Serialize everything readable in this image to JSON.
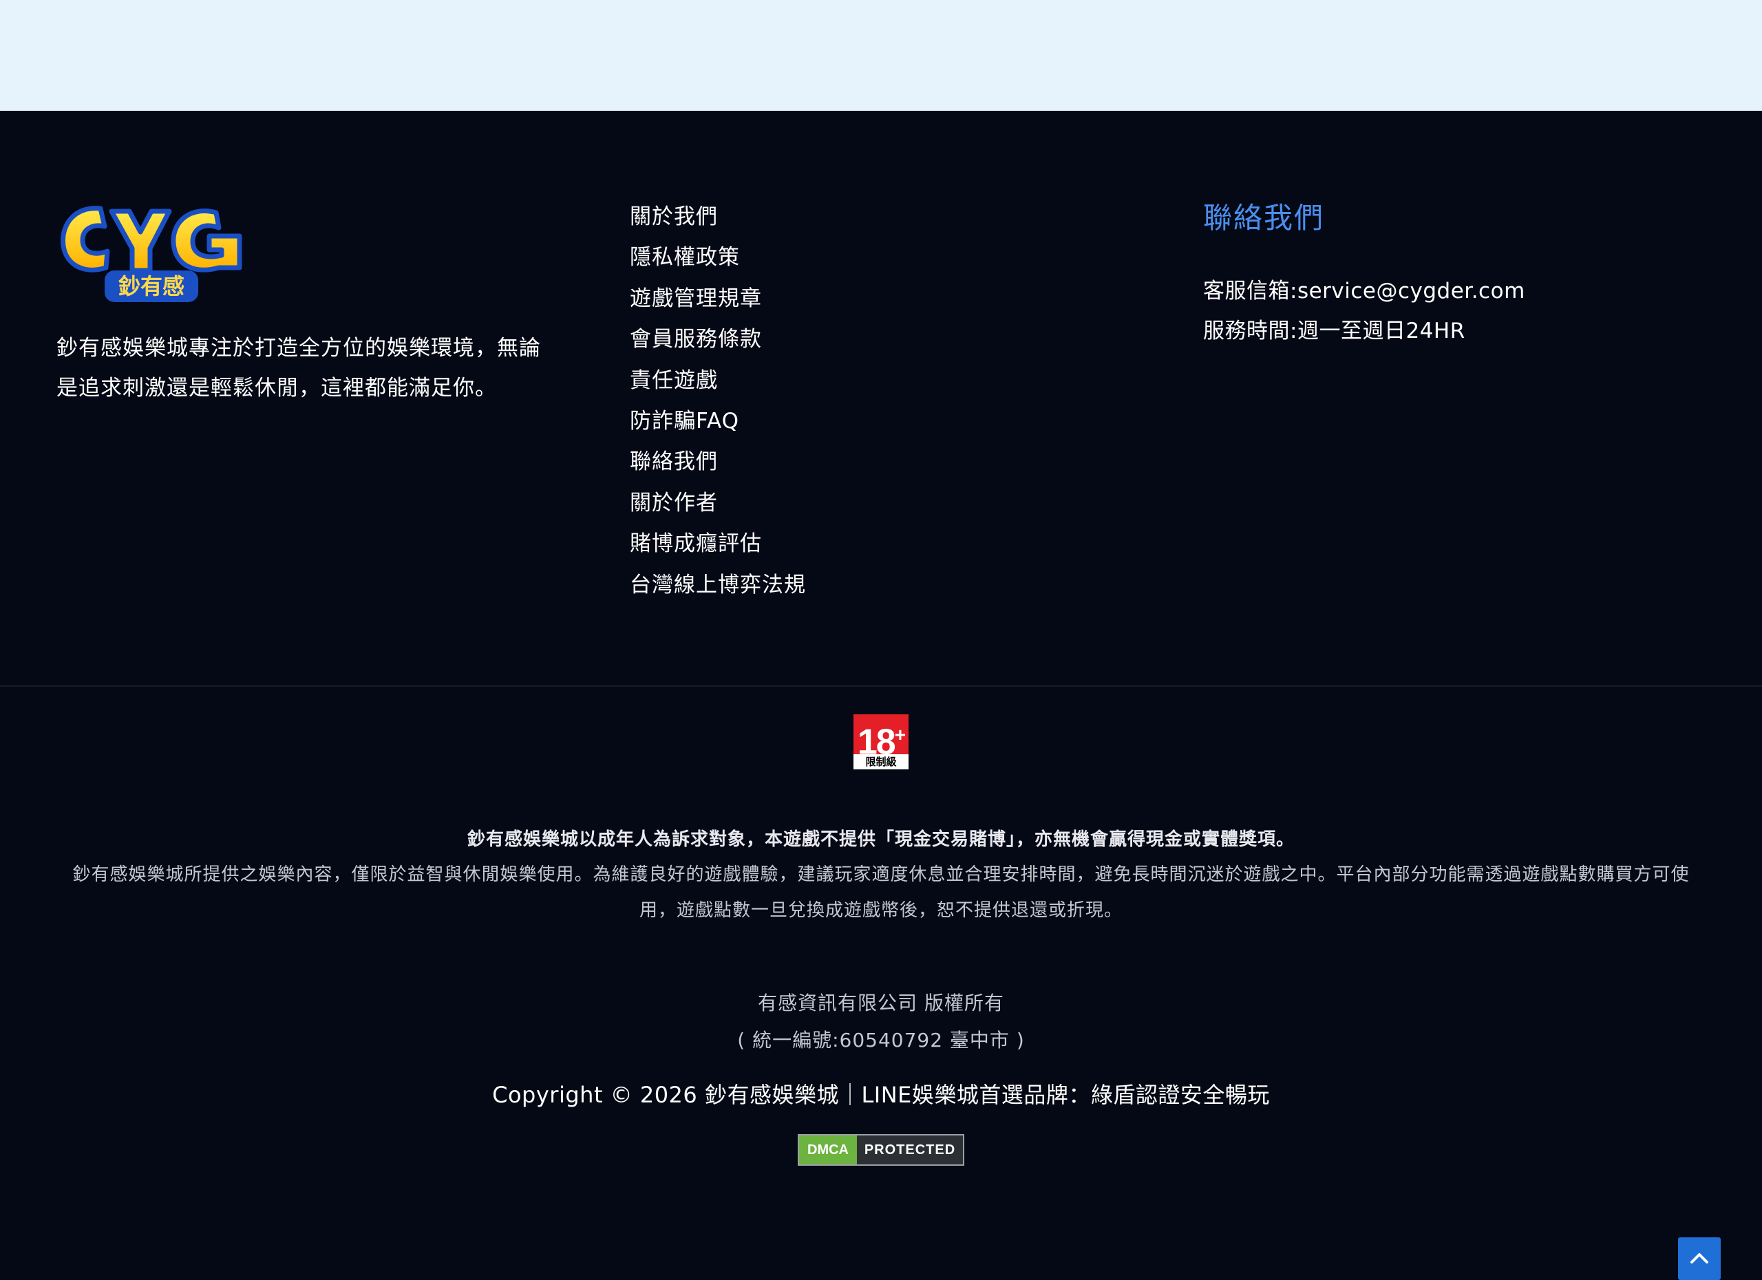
{
  "brand": {
    "logo_text": "CYG",
    "logo_subtext": "鈔有感",
    "description": "鈔有感娛樂城專注於打造全方位的娛樂環境，無論是追求刺激還是輕鬆休閒，這裡都能滿足你。"
  },
  "footer_links": [
    {
      "label": "關於我們"
    },
    {
      "label": "隱私權政策"
    },
    {
      "label": "遊戲管理規章"
    },
    {
      "label": "會員服務條款"
    },
    {
      "label": "責任遊戲"
    },
    {
      "label": "防詐騙FAQ"
    },
    {
      "label": "聯絡我們"
    },
    {
      "label": "關於作者"
    },
    {
      "label": "賭博成癮評估"
    },
    {
      "label": "台灣線上博弈法規"
    }
  ],
  "contact": {
    "heading": "聯絡我們",
    "email": "客服信箱:service@cygder.com",
    "hours": "服務時間:週一至週日24HR"
  },
  "rating_badge": {
    "number": "18",
    "plus": "+",
    "label": "限制級"
  },
  "notice": {
    "headline": "鈔有感娛樂城以成年人為訴求對象，本遊戲不提供「現金交易賭博」，亦無機會贏得現金或實體獎項。",
    "body": "鈔有感娛樂城所提供之娛樂內容，僅限於益智與休閒娛樂使用。為維護良好的遊戲體驗，建議玩家適度休息並合理安排時間，避免長時間沉迷於遊戲之中。平台內部分功能需透過遊戲點數購買方可使用，遊戲點數一旦兌換成遊戲幣後，恕不提供退還或折現。"
  },
  "company": {
    "name": "有感資訊有限公司 版權所有",
    "registration": "( 統一編號:60540792 臺中市 )"
  },
  "copyright": "Copyright © 2026 鈔有感娛樂城｜LINE娛樂城首選品牌：綠盾認證安全暢玩",
  "dmca": {
    "left": "DMCA",
    "right": "PROTECTED"
  },
  "icons": {
    "scroll_top": "chevron-up-icon"
  },
  "colors": {
    "top_band": "#e6f3fc",
    "footer_bg": "#050915",
    "accent": "#4a8ff0",
    "scroll_button": "#1f6fd6"
  }
}
